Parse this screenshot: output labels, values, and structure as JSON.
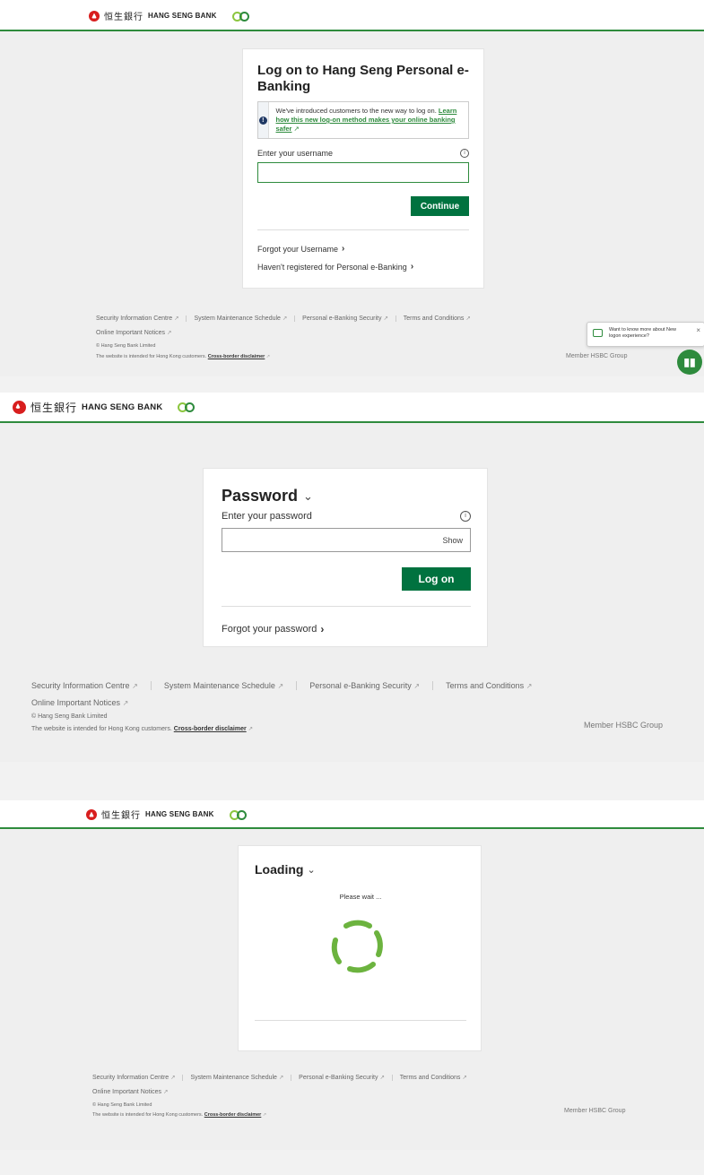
{
  "brand": {
    "zh": "恒生銀行",
    "en": "HANG SENG BANK"
  },
  "screen1": {
    "title": "Log on to Hang Seng Personal e-Banking",
    "notice_text": "We've introduced customers to the new way to log on.",
    "notice_link": "Learn how this new log-on method makes your online banking safer",
    "username_label": "Enter your username",
    "username_value": "",
    "continue_label": "Continue",
    "forgot_username": "Forgot your Username",
    "not_registered": "Haven't registered for Personal e-Banking",
    "chat_prompt": "Want to know more about New logon experience?"
  },
  "screen2": {
    "title": "Password",
    "password_label": "Enter your password",
    "password_value": "",
    "show_label": "Show",
    "logon_label": "Log on",
    "forgot_password": "Forgot your password"
  },
  "screen3": {
    "title": "Loading",
    "message": "Please wait ..."
  },
  "footer": {
    "links": [
      "Security Information Centre",
      "System Maintenance Schedule",
      "Personal e-Banking Security",
      "Terms and Conditions"
    ],
    "notices": "Online Important Notices",
    "copyright": "© Hang Seng Bank Limited",
    "intended": "The website is intended for Hong Kong customers.",
    "disclaimer": "Cross-border disclaimer",
    "member": "Member HSBC Group"
  },
  "colors": {
    "brand_green": "#00723f",
    "accent_green": "#2e8b3d",
    "spinner": "#6cb33f",
    "logo_red": "#d81e1e"
  },
  "icons": [
    "info-icon",
    "external-link-icon",
    "chevron-right-icon",
    "chevron-down-icon",
    "chat-icon",
    "close-icon",
    "spinner-icon"
  ]
}
